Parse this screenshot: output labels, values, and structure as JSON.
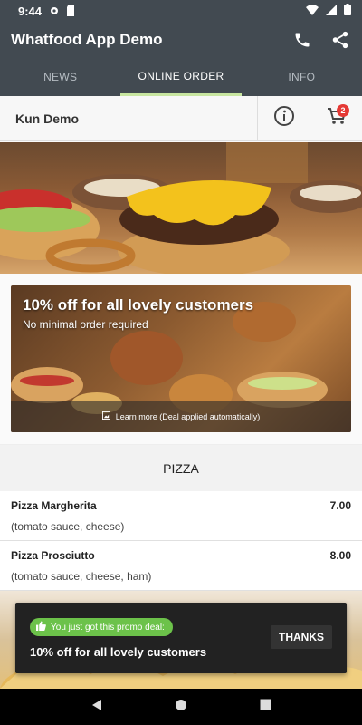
{
  "status_bar": {
    "time": "9:44"
  },
  "app_bar": {
    "title": "Whatfood App Demo"
  },
  "tabs": [
    {
      "label": "NEWS",
      "active": false
    },
    {
      "label": "ONLINE ORDER",
      "active": true
    },
    {
      "label": "INFO",
      "active": false
    }
  ],
  "restaurant": {
    "name": "Kun Demo",
    "cart_count": "2"
  },
  "promo": {
    "title": "10% off for all lovely customers",
    "subtitle": "No minimal order required",
    "learn_more": "Learn more (Deal applied automatically)"
  },
  "section": {
    "title": "PIZZA"
  },
  "menu_items": [
    {
      "name": "Pizza Margherita",
      "price": "7.00",
      "description": "(tomato sauce, cheese)"
    },
    {
      "name": "Pizza Prosciutto",
      "price": "8.00",
      "description": "(tomato sauce, cheese, ham)"
    }
  ],
  "snackbar": {
    "pill_text": "You just got this promo deal:",
    "message": "10% off for all lovely customers",
    "button": "THANKS"
  },
  "colors": {
    "app_bar": "#424a51",
    "accent": "#c8e6a0",
    "badge": "#e53935",
    "pill": "#6cc24a"
  }
}
